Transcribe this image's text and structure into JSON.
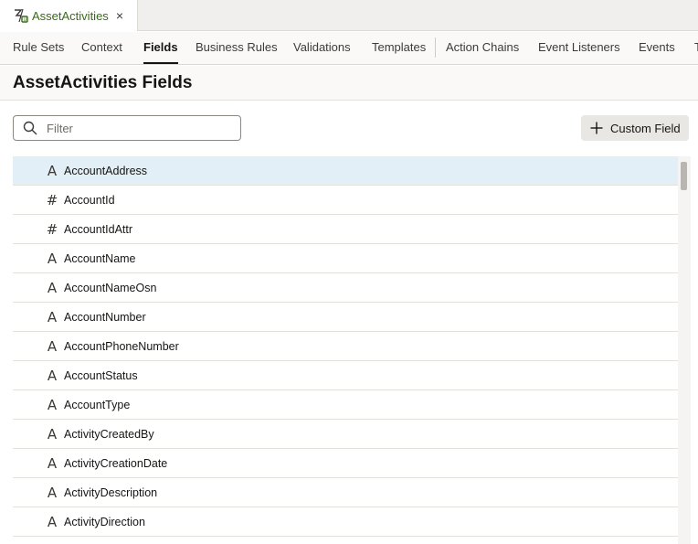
{
  "tab": {
    "label": "AssetActivities",
    "icon": "rules-icon",
    "close": "×"
  },
  "subnav": {
    "items": [
      {
        "label": "Rule Sets",
        "active": false
      },
      {
        "label": "Context",
        "active": false
      },
      {
        "label": "Fields",
        "active": true
      },
      {
        "label": "Business Rules",
        "active": false
      },
      {
        "label": "Validations",
        "active": false
      },
      {
        "label": "Templates",
        "active": false
      },
      {
        "label": "Action Chains",
        "active": false
      },
      {
        "label": "Event Listeners",
        "active": false
      },
      {
        "label": "Events",
        "active": false
      },
      {
        "label": "T",
        "active": false
      }
    ]
  },
  "page": {
    "title": "AssetActivities Fields"
  },
  "filter": {
    "placeholder": "Filter",
    "value": ""
  },
  "custom_field_button": {
    "label": "Custom Field"
  },
  "colors": {
    "accent_green": "#3a6a1a",
    "selected_row": "#e3eff6"
  },
  "fields": [
    {
      "name": "AccountAddress",
      "type_icon": "A",
      "selected": true
    },
    {
      "name": "AccountId",
      "type_icon": "#"
    },
    {
      "name": "AccountIdAttr",
      "type_icon": "#"
    },
    {
      "name": "AccountName",
      "type_icon": "A"
    },
    {
      "name": "AccountNameOsn",
      "type_icon": "A"
    },
    {
      "name": "AccountNumber",
      "type_icon": "A"
    },
    {
      "name": "AccountPhoneNumber",
      "type_icon": "A"
    },
    {
      "name": "AccountStatus",
      "type_icon": "A"
    },
    {
      "name": "AccountType",
      "type_icon": "A"
    },
    {
      "name": "ActivityCreatedBy",
      "type_icon": "A"
    },
    {
      "name": "ActivityCreationDate",
      "type_icon": "A"
    },
    {
      "name": "ActivityDescription",
      "type_icon": "A"
    },
    {
      "name": "ActivityDirection",
      "type_icon": "A"
    }
  ]
}
